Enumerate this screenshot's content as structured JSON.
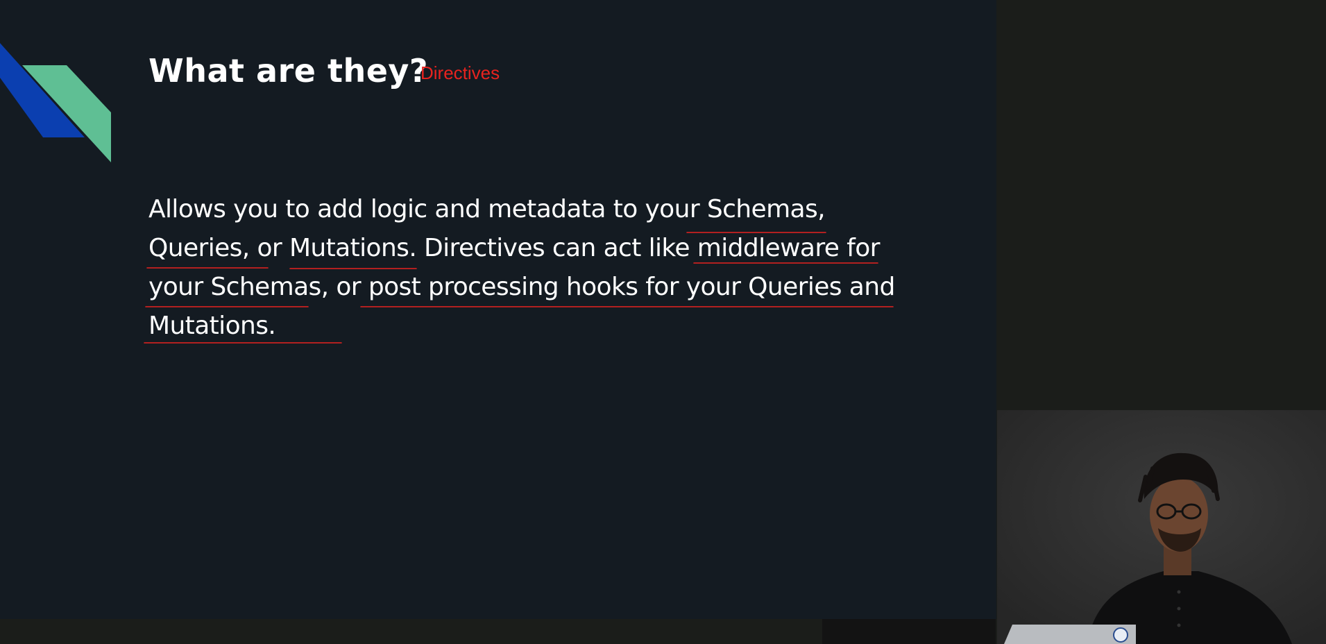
{
  "slide": {
    "title": "What are they?",
    "annotation": "Directives",
    "body": "Allows you to add logic and metadata to your Schemas, Queries, or Mutations. Directives can act like middleware for your Schemas, or post processing hooks for your Queries and Mutations."
  },
  "colors": {
    "slide_background": "#141b22",
    "outer_background": "#1b1d1a",
    "title": "#ffffff",
    "annotation_ink": "#e8231f",
    "decor_blue": "#0b3fb0",
    "decor_green": "#5fbf94"
  },
  "camera": {
    "subject": "presenter-webcam"
  }
}
